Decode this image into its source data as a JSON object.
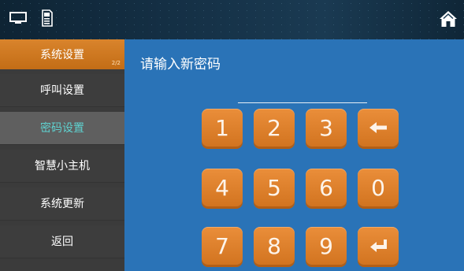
{
  "topbar": {
    "icons": {
      "monitor": "monitor-icon",
      "sdcard": "sd-card-icon",
      "home": "home-icon"
    }
  },
  "sidebar": {
    "header": {
      "label": "系统设置",
      "page_indicator": "2/2"
    },
    "items": [
      {
        "label": "呼叫设置"
      },
      {
        "label": "密码设置",
        "active": true
      },
      {
        "label": "智慧小主机"
      },
      {
        "label": "系统更新"
      },
      {
        "label": "返回"
      }
    ]
  },
  "main": {
    "prompt": "请输入新密码",
    "keypad": {
      "row1": [
        "1",
        "2",
        "3"
      ],
      "row2": [
        "4",
        "5",
        "6",
        "0"
      ],
      "row3": [
        "7",
        "8",
        "9"
      ],
      "icons": {
        "backspace": "backspace-arrow-icon",
        "enter": "enter-return-icon"
      }
    }
  },
  "colors": {
    "accent_orange": "#d97a22",
    "panel_blue": "#2a73b7",
    "sidebar_bg": "#3b3b3b",
    "active_text": "#5fd2d0"
  }
}
